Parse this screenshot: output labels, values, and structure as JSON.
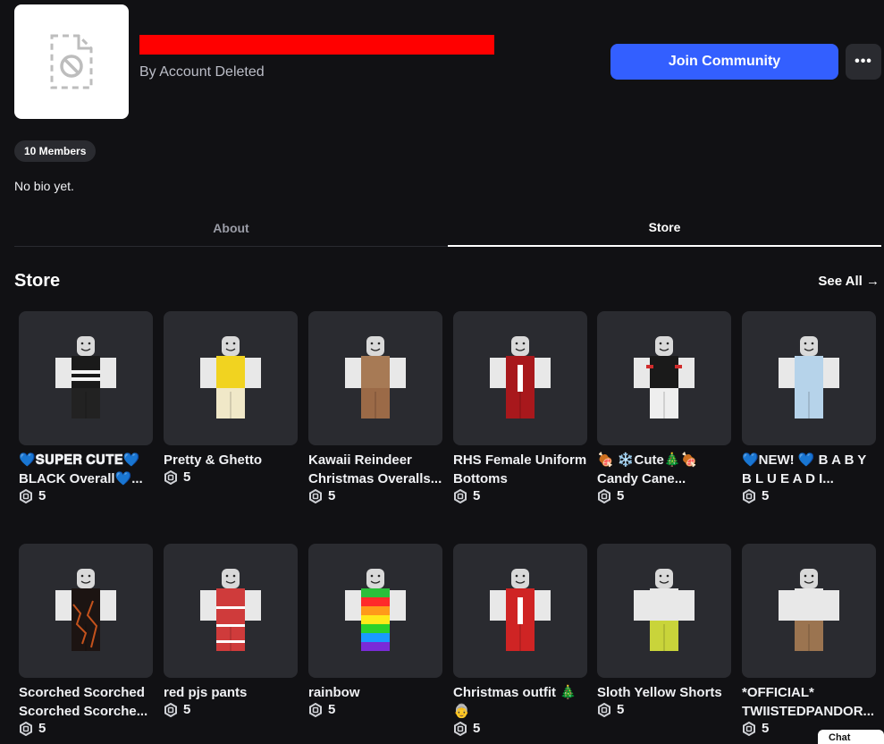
{
  "group": {
    "title": "",
    "byline": "By Account Deleted",
    "members_badge": "10 Members",
    "bio": "No bio yet."
  },
  "actions": {
    "join_label": "Join Community",
    "more_label": "•••"
  },
  "tabs": [
    {
      "label": "About",
      "active": false
    },
    {
      "label": "Store",
      "active": true
    }
  ],
  "store": {
    "title": "Store",
    "see_all": "See All →",
    "items": [
      {
        "name": "💙𝐒𝐔𝐏𝐄𝐑 𝐂𝐔𝐓𝐄💙 BLACK Overall💙...",
        "price": "5",
        "outfit": {
          "torso": "#e8e8e8",
          "shirt": "#1a1a1a",
          "stripe": "#f5f5f5",
          "legs": "#222222",
          "pattern": "stripes"
        }
      },
      {
        "name": "Pretty & Ghetto",
        "price": "5",
        "outfit": {
          "torso": "#e8e8e8",
          "shirt": "#f1d320",
          "stripe": "#f1d320",
          "legs": "#f0e8c8",
          "pattern": "yellow"
        }
      },
      {
        "name": "Kawaii Reindeer Christmas Overalls...",
        "price": "5",
        "outfit": {
          "torso": "#e8e8e8",
          "shirt": "#a77a55",
          "stripe": "#c8352f",
          "legs": "#9b6a47",
          "pattern": "reindeer"
        }
      },
      {
        "name": "RHS Female Uniform Bottoms",
        "price": "5",
        "outfit": {
          "torso": "#e8e8e8",
          "shirt": "#a8181c",
          "stripe": "#ffffff",
          "legs": "#a8181c",
          "pattern": "uniform"
        }
      },
      {
        "name": "🍖 ❄️Cute🎄🍖 Candy Cane...",
        "price": "5",
        "outfit": {
          "torso": "#e8e8e8",
          "shirt": "#1a1a1a",
          "stripe": "#d12d2d",
          "legs": "#eeeeee",
          "pattern": "candy"
        }
      },
      {
        "name": "💙NEW! 💙 B A B Y B L U E A D I...",
        "price": "5",
        "outfit": {
          "torso": "#e8e8e8",
          "shirt": "#b6d3ea",
          "stripe": "#ffffff",
          "legs": "#b6d3ea",
          "pattern": "blue"
        }
      },
      {
        "name": "Scorched Scorched Scorched Scorche...",
        "price": "5",
        "outfit": {
          "torso": "#e8e8e8",
          "shirt": "#1c1412",
          "stripe": "#c4521c",
          "legs": "#1c1412",
          "pattern": "scorched"
        }
      },
      {
        "name": "red pjs pants",
        "price": "5",
        "outfit": {
          "torso": "#e8e8e8",
          "shirt": "#cf3b3b",
          "stripe": "#ffffff",
          "legs": "#cf3b3b",
          "pattern": "pjs"
        }
      },
      {
        "name": "rainbow",
        "price": "5",
        "outfit": {
          "torso": "#e8e8e8",
          "shirt": "#2bbf3a",
          "stripe": "#e43f7a",
          "legs": "#7a2bd8",
          "pattern": "rainbow"
        }
      },
      {
        "name": "Christmas outfit 🎄 👵",
        "price": "5",
        "outfit": {
          "torso": "#e8e8e8",
          "shirt": "#cf2424",
          "stripe": "#ffffff",
          "legs": "#cf2424",
          "pattern": "christmas"
        }
      },
      {
        "name": "Sloth Yellow Shorts",
        "price": "5",
        "outfit": {
          "torso": "#e8e8e8",
          "shirt": "#e8e8e8",
          "stripe": "#e8e8e8",
          "legs": "#c9d43a",
          "pattern": "shorts"
        }
      },
      {
        "name": "*OFFICIAL* TWIISTEDPANDOR...",
        "price": "5",
        "outfit": {
          "torso": "#e8e8e8",
          "shirt": "#e8e8e8",
          "stripe": "#e8e8e8",
          "legs": "#9b7450",
          "pattern": "brown"
        }
      }
    ]
  },
  "chat": {
    "label": "Chat"
  },
  "colors": {
    "accent": "#335fff",
    "background": "#111114",
    "card": "#2a2b30"
  }
}
